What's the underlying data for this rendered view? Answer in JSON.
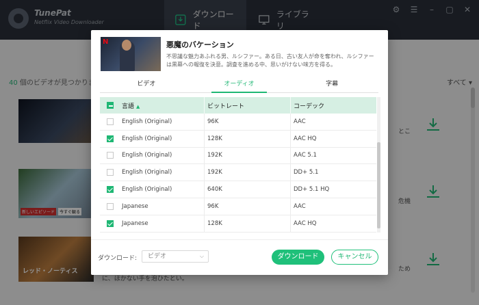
{
  "app": {
    "name": "TunePat",
    "subtitle": "Netflix Video Downloader",
    "tabs": [
      {
        "label": "ダウンロード"
      },
      {
        "label": "ライブラリ"
      }
    ]
  },
  "background": {
    "count_number": "40",
    "count_text": " 個のビデオが見つかりま",
    "sort_label": "すべて ▾",
    "row_snippets": [
      "とこ",
      "危機",
      "ため"
    ],
    "row3_title": "レッド・ノーティス",
    "row3_desc": "に、ほかない手を泡ひたとい。",
    "row2_badge1": "新しいエピソード",
    "row2_badge2": "今すぐ観る"
  },
  "dialog": {
    "title": "悪魔のバケーション",
    "description": "不思議な魅力あふれる男、ルシファー。ある日、古い友人が命を奪われ、ルシファーは黒幕への報復を決意。調査を進める中、思いがけない味方を得る。",
    "tabs": [
      {
        "label": "ビデオ",
        "active": false
      },
      {
        "label": "オーディオ",
        "active": true
      },
      {
        "label": "字幕",
        "active": false
      }
    ],
    "table": {
      "headers": [
        "言語",
        "ビットレート",
        "コーデック"
      ],
      "rows": [
        {
          "language": "English (Original)",
          "bitrate": "96K",
          "codec": "AAC",
          "checked": false
        },
        {
          "language": "English (Original)",
          "bitrate": "128K",
          "codec": "AAC HQ",
          "checked": true
        },
        {
          "language": "English (Original)",
          "bitrate": "192K",
          "codec": "AAC 5.1",
          "checked": false
        },
        {
          "language": "English (Original)",
          "bitrate": "192K",
          "codec": "DD+ 5.1",
          "checked": false
        },
        {
          "language": "English (Original)",
          "bitrate": "640K",
          "codec": "DD+ 5.1 HQ",
          "checked": true
        },
        {
          "language": "Japanese",
          "bitrate": "96K",
          "codec": "AAC",
          "checked": false
        },
        {
          "language": "Japanese",
          "bitrate": "128K",
          "codec": "AAC HQ",
          "checked": true
        }
      ]
    },
    "footer": {
      "download_label": "ダウンロード:",
      "select_value": "ビデオ",
      "download_button": "ダウンロード",
      "cancel_button": "キャンセル"
    }
  },
  "colors": {
    "accent": "#1fb774",
    "titlebar": "#2a3039",
    "header_row": "#d6efe3"
  }
}
